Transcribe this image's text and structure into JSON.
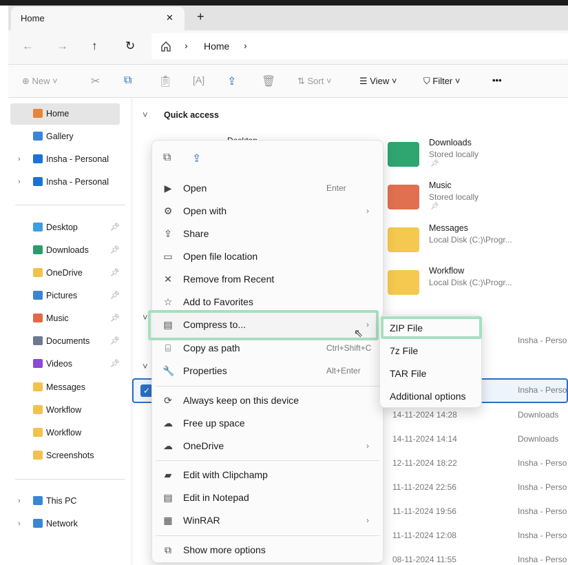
{
  "window": {
    "tab_title": "Home",
    "close": "✕",
    "new_tab": "+"
  },
  "nav": {
    "back": "←",
    "forward": "→",
    "up": "↑",
    "refresh": "↻",
    "breadcrumb": [
      "Home"
    ]
  },
  "toolbar": {
    "new": "New",
    "sort": "Sort",
    "view": "View",
    "filter": "Filter",
    "more": "•••"
  },
  "sidebar": {
    "items": [
      {
        "label": "Home",
        "icon": "home-icon",
        "color": "#e8833a"
      },
      {
        "label": "Gallery",
        "icon": "gallery-icon",
        "color": "#3a86d4"
      },
      {
        "label": "Insha - Personal",
        "icon": "onedrive-icon",
        "color": "#1a73d4",
        "expandable": true
      },
      {
        "label": "Insha - Personal",
        "icon": "onedrive-icon",
        "color": "#1a73d4",
        "expandable": true
      },
      {
        "label": "Desktop",
        "icon": "desktop-icon",
        "color": "#3aa0e0",
        "pinned": true
      },
      {
        "label": "Downloads",
        "icon": "downloads-icon",
        "color": "#2a9d6e",
        "pinned": true
      },
      {
        "label": "OneDrive",
        "icon": "folder-icon",
        "color": "#f2c14e",
        "pinned": true
      },
      {
        "label": "Pictures",
        "icon": "pictures-icon",
        "color": "#3a86d4",
        "pinned": true
      },
      {
        "label": "Music",
        "icon": "music-icon",
        "color": "#e06a4a",
        "pinned": true
      },
      {
        "label": "Documents",
        "icon": "documents-icon",
        "color": "#6b7a8f",
        "pinned": true
      },
      {
        "label": "Videos",
        "icon": "videos-icon",
        "color": "#8a4ad4",
        "pinned": true
      },
      {
        "label": "Messages",
        "icon": "folder-icon",
        "color": "#f2c14e"
      },
      {
        "label": "Workflow",
        "icon": "folder-icon",
        "color": "#f2c14e"
      },
      {
        "label": "Workflow",
        "icon": "folder-icon",
        "color": "#f2c14e"
      },
      {
        "label": "Screenshots",
        "icon": "folder-icon",
        "color": "#f2c14e"
      },
      {
        "label": "This PC",
        "icon": "pc-icon",
        "color": "#3a86d4",
        "expandable": true
      },
      {
        "label": "Network",
        "icon": "network-icon",
        "color": "#3a86d4",
        "expandable": true
      }
    ]
  },
  "main": {
    "quick_access": "Quick access",
    "partial_item": "Desktop",
    "tiles": [
      {
        "name": "Downloads",
        "sub": "Stored locally",
        "color": "#2fa56f"
      },
      {
        "name": "Music",
        "sub": "Stored locally",
        "color": "#e0704f"
      },
      {
        "name": "Messages",
        "sub": "Local Disk (C:)\\Progr...",
        "color": "#f5c84f"
      },
      {
        "name": "Workflow",
        "sub": "Local Disk (C:)\\Progr...",
        "color": "#f5c84f"
      }
    ],
    "rows": [
      {
        "date": "",
        "loc": "Insha - Perso"
      },
      {
        "date": "",
        "loc": "Insha - Perso",
        "selected": true
      },
      {
        "date": "14-11-2024 14:28",
        "loc": "Downloads"
      },
      {
        "date": "14-11-2024 14:14",
        "loc": "Downloads"
      },
      {
        "date": "12-11-2024 18:22",
        "loc": "Insha - Perso"
      },
      {
        "date": "11-11-2024 22:56",
        "loc": "Insha - Perso"
      },
      {
        "date": "11-11-2024 19:56",
        "loc": "Insha - Perso"
      },
      {
        "date": "11-11-2024 12:08",
        "loc": "Insha - Perso"
      },
      {
        "date": "08-11-2024 11:55",
        "loc": "Insha - Perso"
      }
    ]
  },
  "context_menu": {
    "items": [
      {
        "label": "Open",
        "shortcut": "Enter",
        "icon": "▶"
      },
      {
        "label": "Open with",
        "arrow": "›",
        "icon": "⚙"
      },
      {
        "label": "Share",
        "icon": "⇪"
      },
      {
        "label": "Open file location",
        "icon": "▭"
      },
      {
        "label": "Remove from Recent",
        "icon": "✕"
      },
      {
        "label": "Add to Favorites",
        "icon": "☆"
      },
      {
        "label": "Compress to...",
        "arrow": "›",
        "icon": "▤"
      },
      {
        "label": "Copy as path",
        "shortcut": "Ctrl+Shift+C",
        "icon": "⌸"
      },
      {
        "label": "Properties",
        "shortcut": "Alt+Enter",
        "icon": "🔧"
      },
      {
        "label": "Always keep on this device",
        "icon": "⟳"
      },
      {
        "label": "Free up space",
        "icon": "☁"
      },
      {
        "label": "OneDrive",
        "arrow": "›",
        "icon": "☁"
      },
      {
        "label": "Edit with Clipchamp",
        "icon": "▰"
      },
      {
        "label": "Edit in Notepad",
        "icon": "▤"
      },
      {
        "label": "WinRAR",
        "arrow": "›",
        "icon": "▦"
      },
      {
        "label": "Show more options",
        "icon": "⧉"
      }
    ]
  },
  "submenu": {
    "items": [
      "ZIP File",
      "7z File",
      "TAR File",
      "Additional options"
    ]
  }
}
